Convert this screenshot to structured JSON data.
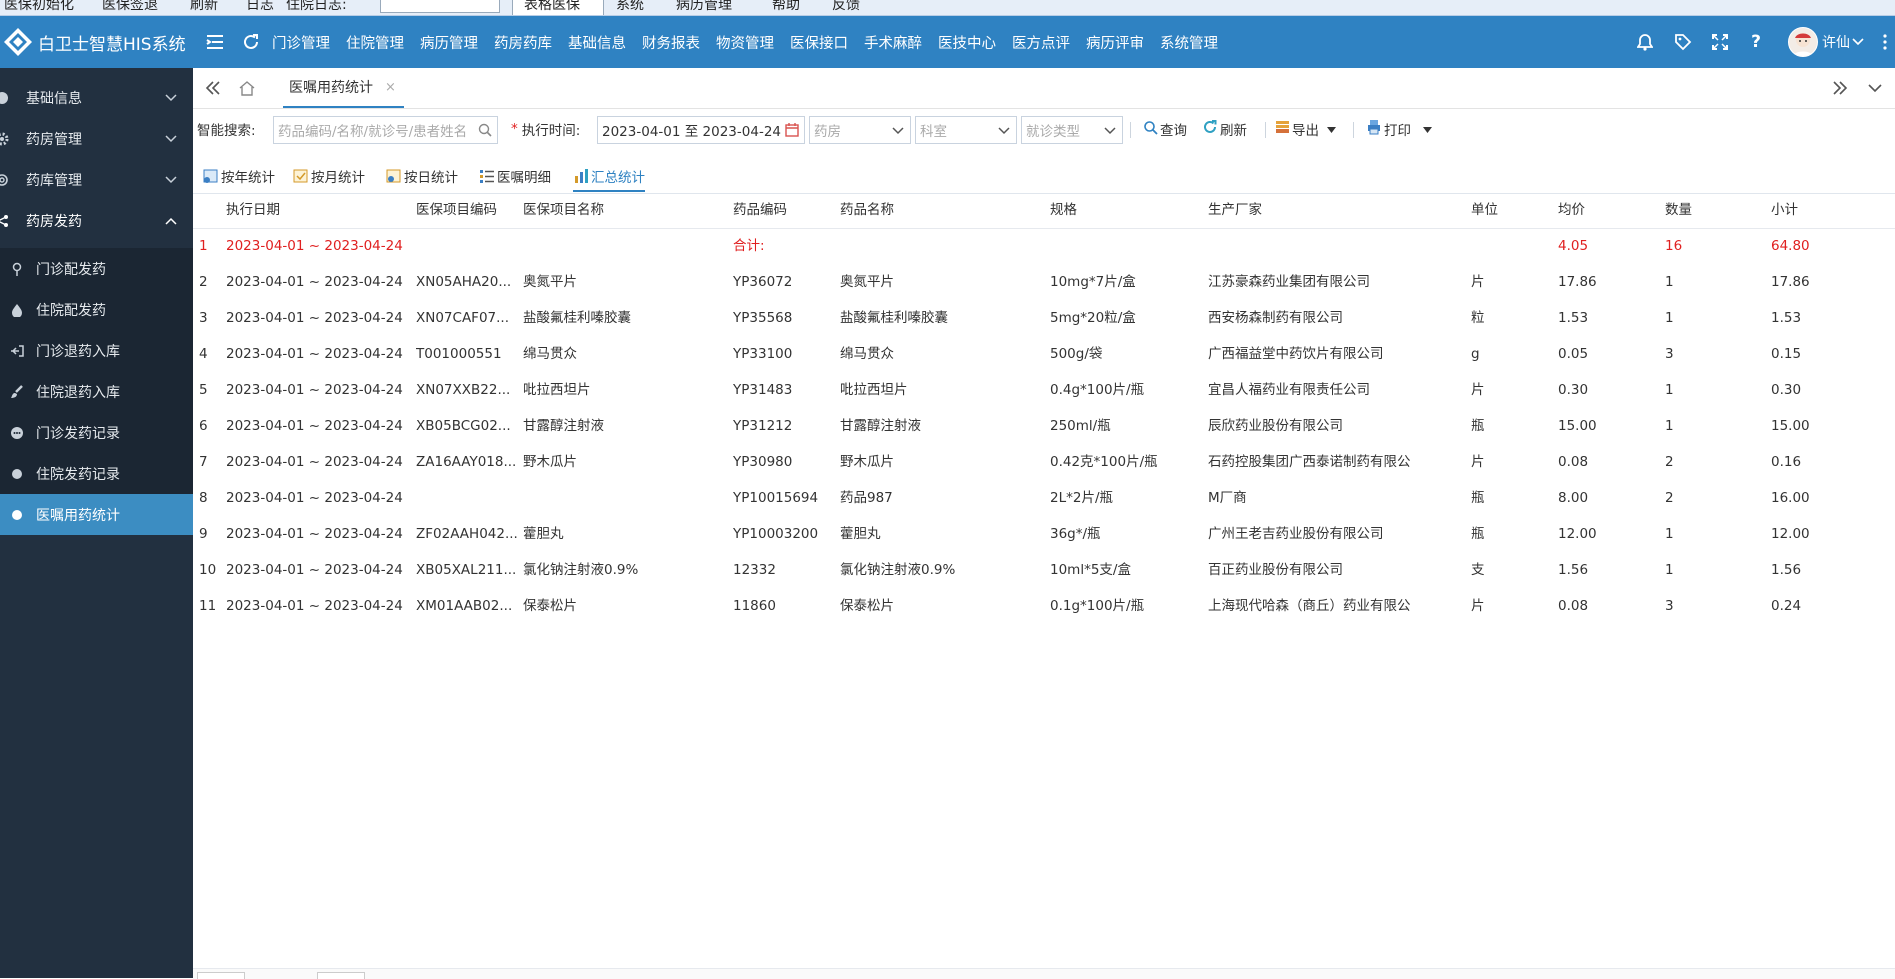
{
  "ribbon": {
    "items": [
      "医保初始化",
      "医保签退",
      "刷新",
      "日志",
      "住院日志:",
      "表格医保",
      "系统",
      "病历管理",
      "帮助",
      "反馈"
    ]
  },
  "header": {
    "app_name": "白卫士智慧HIS系统",
    "menu": [
      "门诊管理",
      "住院管理",
      "病历管理",
      "药房药库",
      "基础信息",
      "财务报表",
      "物资管理",
      "医保接口",
      "手术麻醉",
      "医技中心",
      "医方点评",
      "病历评审",
      "系统管理"
    ],
    "user_name": "许仙"
  },
  "sidebar": {
    "groups": [
      {
        "label": "基础信息",
        "icon": "circle-icon",
        "chevron": "chevron-down"
      },
      {
        "label": "药房管理",
        "icon": "gear-icon",
        "chevron": "chevron-down"
      },
      {
        "label": "药库管理",
        "icon": "gear-icon",
        "chevron": "chevron-down"
      },
      {
        "label": "药房发药",
        "icon": "share-icon",
        "chevron": "chevron-up"
      }
    ],
    "items": [
      {
        "label": "门诊配发药",
        "icon": "pin-icon"
      },
      {
        "label": "住院配发药",
        "icon": "drop-icon"
      },
      {
        "label": "门诊退药入库",
        "icon": "return-icon"
      },
      {
        "label": "住院退药入库",
        "icon": "brush-icon"
      },
      {
        "label": "门诊发药记录",
        "icon": "chat-icon"
      },
      {
        "label": "住院发药记录",
        "icon": "dot-icon"
      },
      {
        "label": "医嘱用药统计",
        "icon": "dot-icon",
        "active": true
      }
    ]
  },
  "tabbar": {
    "active_tab": "医嘱用药统计",
    "close_glyph": "×"
  },
  "search": {
    "smart_label": "智能搜索:",
    "smart_placeholder": "药品编码/名称/就诊号/患者姓名",
    "exec_time_label": "执行时间:",
    "date_range": "2023-04-01 至 2023-04-24",
    "pharmacy_placeholder": "药房",
    "dept_placeholder": "科室",
    "visit_type_placeholder": "就诊类型",
    "query_label": "查询",
    "refresh_label": "刷新",
    "export_label": "导出",
    "print_label": "打印"
  },
  "subtabs": [
    "按年统计",
    "按月统计",
    "按日统计",
    "医嘱明细",
    "汇总统计"
  ],
  "active_subtab": "汇总统计",
  "table": {
    "columns": [
      "执行日期",
      "医保项目编码",
      "医保项目名称",
      "药品编码",
      "药品名称",
      "规格",
      "生产厂家",
      "单位",
      "均价",
      "数量",
      "小计"
    ],
    "rows": [
      {
        "no": "1",
        "date": "2023-04-01 ~ 2023-04-24",
        "ybcode": "",
        "ybname": "",
        "code": "合计:",
        "name": "",
        "spec": "",
        "maker": "",
        "unit": "",
        "price": "4.05",
        "qty": "16",
        "subtotal": "64.80",
        "summary": true
      },
      {
        "no": "2",
        "date": "2023-04-01 ~ 2023-04-24",
        "ybcode": "XN05AHA20...",
        "ybname": "奥氮平片",
        "code": "YP36072",
        "name": "奥氮平片",
        "spec": "10mg*7片/盒",
        "maker": "江苏豪森药业集团有限公司",
        "unit": "片",
        "price": "17.86",
        "qty": "1",
        "subtotal": "17.86"
      },
      {
        "no": "3",
        "date": "2023-04-01 ~ 2023-04-24",
        "ybcode": "XN07CAF07...",
        "ybname": "盐酸氟桂利嗪胶囊",
        "code": "YP35568",
        "name": "盐酸氟桂利嗪胶囊",
        "spec": "5mg*20粒/盒",
        "maker": "西安杨森制药有限公司",
        "unit": "粒",
        "price": "1.53",
        "qty": "1",
        "subtotal": "1.53"
      },
      {
        "no": "4",
        "date": "2023-04-01 ~ 2023-04-24",
        "ybcode": "T001000551",
        "ybname": "绵马贯众",
        "code": "YP33100",
        "name": "绵马贯众",
        "spec": "500g/袋",
        "maker": "广西福益堂中药饮片有限公司",
        "unit": "g",
        "price": "0.05",
        "qty": "3",
        "subtotal": "0.15"
      },
      {
        "no": "5",
        "date": "2023-04-01 ~ 2023-04-24",
        "ybcode": "XN07XXB22...",
        "ybname": "吡拉西坦片",
        "code": "YP31483",
        "name": "吡拉西坦片",
        "spec": "0.4g*100片/瓶",
        "maker": "宜昌人福药业有限责任公司",
        "unit": "片",
        "price": "0.30",
        "qty": "1",
        "subtotal": "0.30"
      },
      {
        "no": "6",
        "date": "2023-04-01 ~ 2023-04-24",
        "ybcode": "XB05BCG02...",
        "ybname": "甘露醇注射液",
        "code": "YP31212",
        "name": "甘露醇注射液",
        "spec": "250ml/瓶",
        "maker": "辰欣药业股份有限公司",
        "unit": "瓶",
        "price": "15.00",
        "qty": "1",
        "subtotal": "15.00"
      },
      {
        "no": "7",
        "date": "2023-04-01 ~ 2023-04-24",
        "ybcode": "ZA16AAY018...",
        "ybname": "野木瓜片",
        "code": "YP30980",
        "name": "野木瓜片",
        "spec": "0.42克*100片/瓶",
        "maker": "石药控股集团广西泰诺制药有限公",
        "unit": "片",
        "price": "0.08",
        "qty": "2",
        "subtotal": "0.16"
      },
      {
        "no": "8",
        "date": "2023-04-01 ~ 2023-04-24",
        "ybcode": "",
        "ybname": "",
        "code": "YP10015694",
        "name": "药品987",
        "spec": "2L*2片/瓶",
        "maker": "M厂商",
        "unit": "瓶",
        "price": "8.00",
        "qty": "2",
        "subtotal": "16.00"
      },
      {
        "no": "9",
        "date": "2023-04-01 ~ 2023-04-24",
        "ybcode": "ZF02AAH042...",
        "ybname": "藿胆丸",
        "code": "YP10003200",
        "name": "藿胆丸",
        "spec": "36g*/瓶",
        "maker": "广州王老吉药业股份有限公司",
        "unit": "瓶",
        "price": "12.00",
        "qty": "1",
        "subtotal": "12.00"
      },
      {
        "no": "10",
        "date": "2023-04-01 ~ 2023-04-24",
        "ybcode": "XB05XAL211...",
        "ybname": "氯化钠注射液0.9%",
        "code": "12332",
        "name": "氯化钠注射液0.9%",
        "spec": "10ml*5支/盒",
        "maker": "百正药业股份有限公司",
        "unit": "支",
        "price": "1.56",
        "qty": "1",
        "subtotal": "1.56"
      },
      {
        "no": "11",
        "date": "2023-04-01 ~ 2023-04-24",
        "ybcode": "XM01AAB02...",
        "ybname": "保泰松片",
        "code": "11860",
        "name": "保泰松片",
        "spec": "0.1g*100片/瓶",
        "maker": "上海现代哈森（商丘）药业有限公",
        "unit": "片",
        "price": "0.08",
        "qty": "3",
        "subtotal": "0.24"
      }
    ]
  },
  "colors": {
    "header_bg": "#2f82c2",
    "sidebar_bg": "#223040",
    "sidebar_active": "#3c8dc2",
    "summary_text": "#e02020"
  }
}
